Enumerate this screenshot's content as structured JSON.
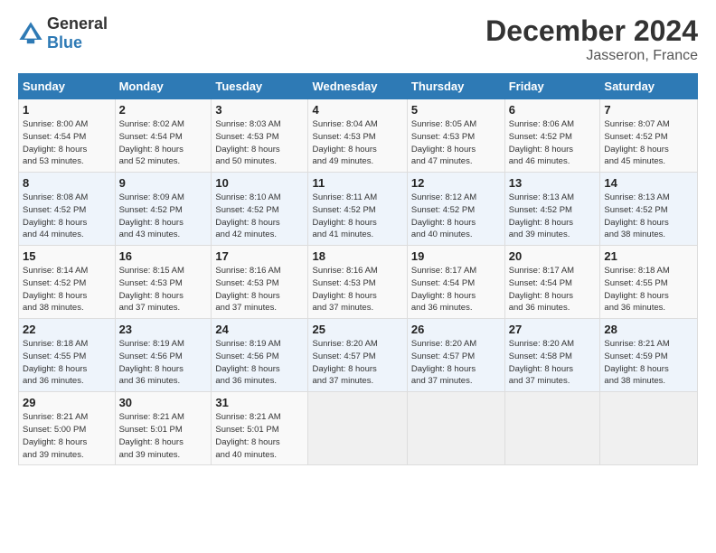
{
  "header": {
    "logo_general": "General",
    "logo_blue": "Blue",
    "main_title": "December 2024",
    "subtitle": "Jasseron, France"
  },
  "days_of_week": [
    "Sunday",
    "Monday",
    "Tuesday",
    "Wednesday",
    "Thursday",
    "Friday",
    "Saturday"
  ],
  "weeks": [
    [
      {
        "day": "1",
        "sunrise": "8:00 AM",
        "sunset": "4:54 PM",
        "daylight": "8 hours and 53 minutes."
      },
      {
        "day": "2",
        "sunrise": "8:02 AM",
        "sunset": "4:54 PM",
        "daylight": "8 hours and 52 minutes."
      },
      {
        "day": "3",
        "sunrise": "8:03 AM",
        "sunset": "4:53 PM",
        "daylight": "8 hours and 50 minutes."
      },
      {
        "day": "4",
        "sunrise": "8:04 AM",
        "sunset": "4:53 PM",
        "daylight": "8 hours and 49 minutes."
      },
      {
        "day": "5",
        "sunrise": "8:05 AM",
        "sunset": "4:53 PM",
        "daylight": "8 hours and 47 minutes."
      },
      {
        "day": "6",
        "sunrise": "8:06 AM",
        "sunset": "4:52 PM",
        "daylight": "8 hours and 46 minutes."
      },
      {
        "day": "7",
        "sunrise": "8:07 AM",
        "sunset": "4:52 PM",
        "daylight": "8 hours and 45 minutes."
      }
    ],
    [
      {
        "day": "8",
        "sunrise": "8:08 AM",
        "sunset": "4:52 PM",
        "daylight": "8 hours and 44 minutes."
      },
      {
        "day": "9",
        "sunrise": "8:09 AM",
        "sunset": "4:52 PM",
        "daylight": "8 hours and 43 minutes."
      },
      {
        "day": "10",
        "sunrise": "8:10 AM",
        "sunset": "4:52 PM",
        "daylight": "8 hours and 42 minutes."
      },
      {
        "day": "11",
        "sunrise": "8:11 AM",
        "sunset": "4:52 PM",
        "daylight": "8 hours and 41 minutes."
      },
      {
        "day": "12",
        "sunrise": "8:12 AM",
        "sunset": "4:52 PM",
        "daylight": "8 hours and 40 minutes."
      },
      {
        "day": "13",
        "sunrise": "8:13 AM",
        "sunset": "4:52 PM",
        "daylight": "8 hours and 39 minutes."
      },
      {
        "day": "14",
        "sunrise": "8:13 AM",
        "sunset": "4:52 PM",
        "daylight": "8 hours and 38 minutes."
      }
    ],
    [
      {
        "day": "15",
        "sunrise": "8:14 AM",
        "sunset": "4:52 PM",
        "daylight": "8 hours and 38 minutes."
      },
      {
        "day": "16",
        "sunrise": "8:15 AM",
        "sunset": "4:53 PM",
        "daylight": "8 hours and 37 minutes."
      },
      {
        "day": "17",
        "sunrise": "8:16 AM",
        "sunset": "4:53 PM",
        "daylight": "8 hours and 37 minutes."
      },
      {
        "day": "18",
        "sunrise": "8:16 AM",
        "sunset": "4:53 PM",
        "daylight": "8 hours and 37 minutes."
      },
      {
        "day": "19",
        "sunrise": "8:17 AM",
        "sunset": "4:54 PM",
        "daylight": "8 hours and 36 minutes."
      },
      {
        "day": "20",
        "sunrise": "8:17 AM",
        "sunset": "4:54 PM",
        "daylight": "8 hours and 36 minutes."
      },
      {
        "day": "21",
        "sunrise": "8:18 AM",
        "sunset": "4:55 PM",
        "daylight": "8 hours and 36 minutes."
      }
    ],
    [
      {
        "day": "22",
        "sunrise": "8:18 AM",
        "sunset": "4:55 PM",
        "daylight": "8 hours and 36 minutes."
      },
      {
        "day": "23",
        "sunrise": "8:19 AM",
        "sunset": "4:56 PM",
        "daylight": "8 hours and 36 minutes."
      },
      {
        "day": "24",
        "sunrise": "8:19 AM",
        "sunset": "4:56 PM",
        "daylight": "8 hours and 36 minutes."
      },
      {
        "day": "25",
        "sunrise": "8:20 AM",
        "sunset": "4:57 PM",
        "daylight": "8 hours and 37 minutes."
      },
      {
        "day": "26",
        "sunrise": "8:20 AM",
        "sunset": "4:57 PM",
        "daylight": "8 hours and 37 minutes."
      },
      {
        "day": "27",
        "sunrise": "8:20 AM",
        "sunset": "4:58 PM",
        "daylight": "8 hours and 37 minutes."
      },
      {
        "day": "28",
        "sunrise": "8:21 AM",
        "sunset": "4:59 PM",
        "daylight": "8 hours and 38 minutes."
      }
    ],
    [
      {
        "day": "29",
        "sunrise": "8:21 AM",
        "sunset": "5:00 PM",
        "daylight": "8 hours and 39 minutes."
      },
      {
        "day": "30",
        "sunrise": "8:21 AM",
        "sunset": "5:01 PM",
        "daylight": "8 hours and 39 minutes."
      },
      {
        "day": "31",
        "sunrise": "8:21 AM",
        "sunset": "5:01 PM",
        "daylight": "8 hours and 40 minutes."
      },
      null,
      null,
      null,
      null
    ]
  ]
}
